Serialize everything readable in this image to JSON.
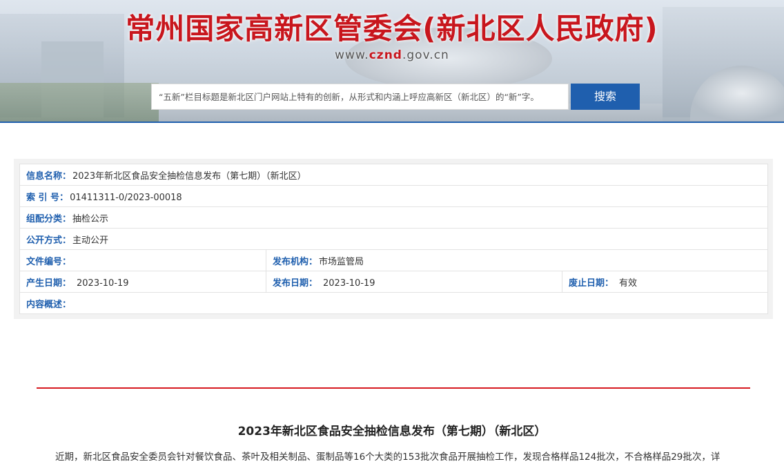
{
  "header": {
    "site_title": "常州国家高新区管委会(新北区人民政府)",
    "url_prefix": "www.",
    "url_highlight": "cznd",
    "url_suffix": ".gov.cn",
    "search_placeholder": "“五新”栏目标题是新北区门户网站上特有的创新，从形式和内涵上呼应高新区（新北区）的“新”字。",
    "search_button": "搜索",
    "brand_color": "#c8161d",
    "accent_color": "#1f5fae"
  },
  "info": {
    "name_label": "信息名称：",
    "name_value": "2023年新北区食品安全抽检信息发布（第七期）（新北区）",
    "index_label": "索 引 号：",
    "index_value": "01411311-0/2023-00018",
    "category_label": "组配分类：",
    "category_value": "抽检公示",
    "open_label": "公开方式：",
    "open_value": "主动公开",
    "file_no_label": "文件编号：",
    "file_no_value": "",
    "org_label": "发布机构：",
    "org_value": "市场监管局",
    "created_label": "产生日期：",
    "created_value": "2023-10-19",
    "published_label": "发布日期：",
    "published_value": "2023-10-19",
    "expire_label": "废止日期：",
    "expire_value": "有效",
    "summary_label": "内容概述：",
    "summary_value": ""
  },
  "article": {
    "title": "2023年新北区食品安全抽检信息发布（第七期）（新北区）",
    "paragraph": "近期，新北区食品安全委员会针对餐饮食品、茶叶及相关制品、蛋制品等16个大类的153批次食品开展抽检工作，发现合格样品124批次，不合格样品29批次，详"
  }
}
